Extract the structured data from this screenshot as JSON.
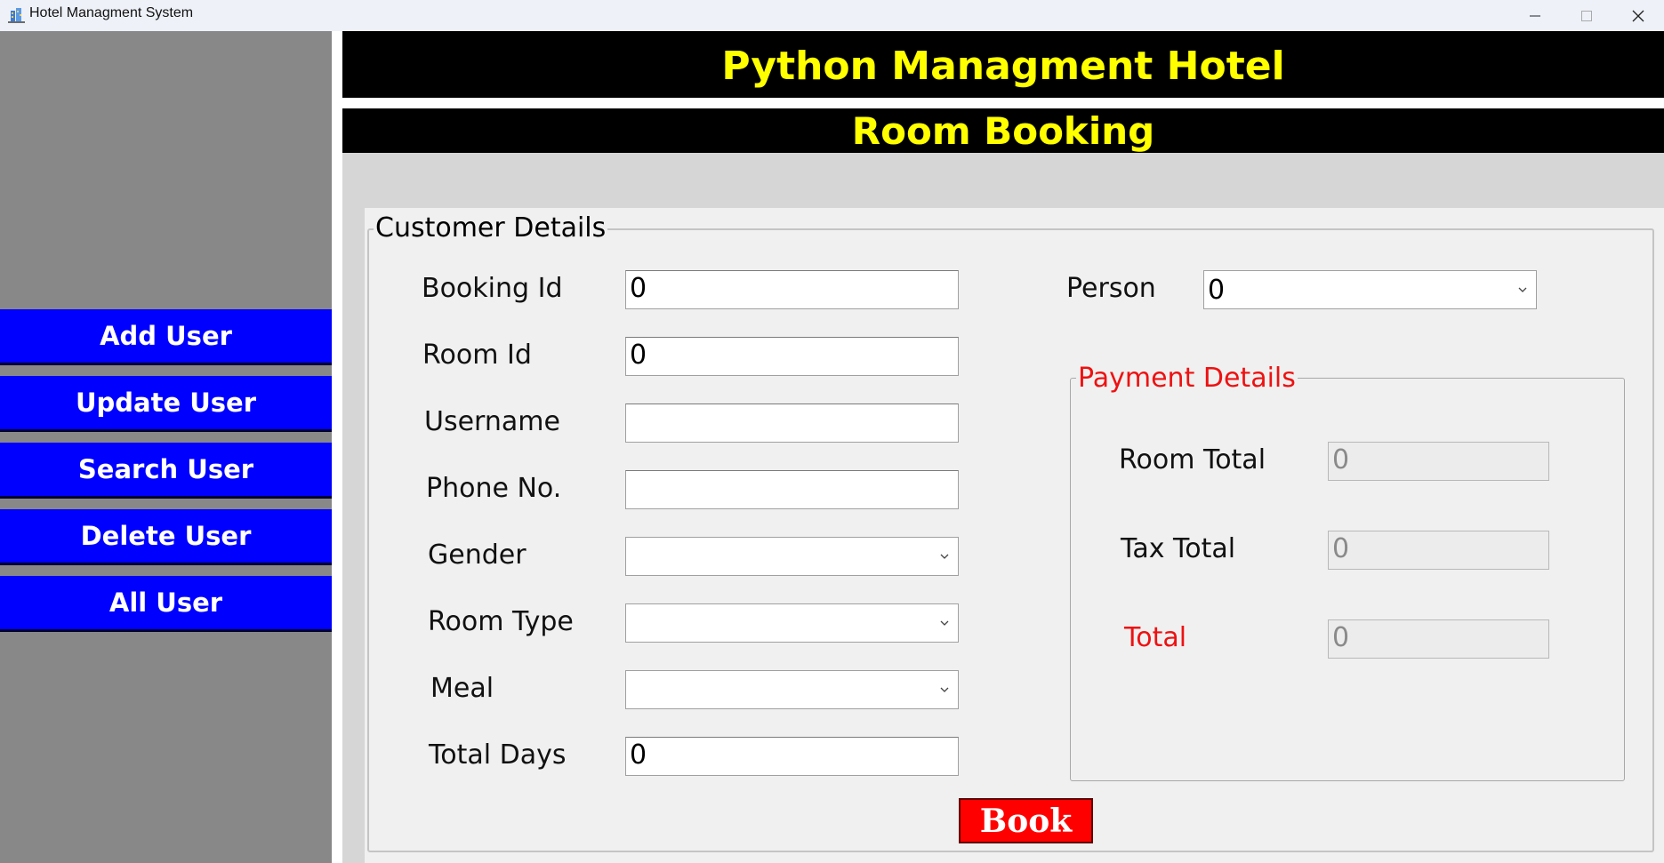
{
  "window": {
    "title": "Hotel Managment System",
    "icon": "hotel-app-icon",
    "controls": [
      "minimize-icon",
      "maximize-icon",
      "close-icon"
    ]
  },
  "sidebar": {
    "items": [
      {
        "label": "Add User"
      },
      {
        "label": "Update User"
      },
      {
        "label": "Search User"
      },
      {
        "label": "Delete User"
      },
      {
        "label": "All User"
      }
    ]
  },
  "header": {
    "title": "Python Managment Hotel",
    "subtitle": "Room Booking"
  },
  "customer": {
    "legend": "Customer Details",
    "booking_id": {
      "label": "Booking Id",
      "value": "0"
    },
    "room_id": {
      "label": "Room Id",
      "value": "0"
    },
    "username": {
      "label": "Username",
      "value": ""
    },
    "phone": {
      "label": "Phone No.",
      "value": ""
    },
    "gender": {
      "label": "Gender",
      "value": ""
    },
    "room_type": {
      "label": "Room Type",
      "value": ""
    },
    "meal": {
      "label": "Meal",
      "value": ""
    },
    "total_days": {
      "label": "Total Days",
      "value": "0"
    },
    "person": {
      "label": "Person",
      "value": "0"
    }
  },
  "payment": {
    "legend": "Payment Details",
    "room_total": {
      "label": "Room Total",
      "value": "0"
    },
    "tax_total": {
      "label": "Tax Total",
      "value": "0"
    },
    "total": {
      "label": "Total",
      "value": "0"
    }
  },
  "actions": {
    "book_label": "Book"
  },
  "colors": {
    "sidebar_bg": "#888888",
    "sidebar_button": "#0000ff",
    "header_bg": "#000000",
    "header_text": "#ffff00",
    "book_button": "#ff0000",
    "payment_accent": "#ee1111"
  }
}
